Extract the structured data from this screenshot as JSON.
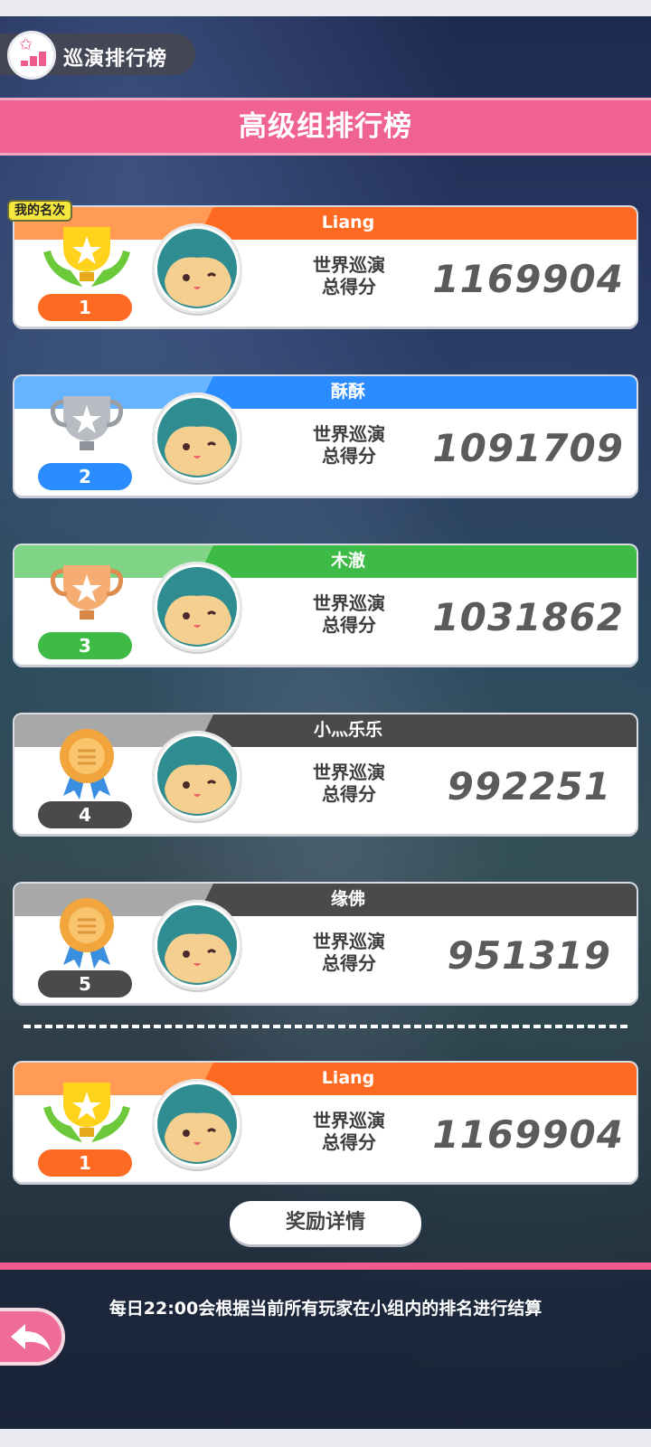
{
  "header": {
    "tab_label": "巡演排行榜",
    "title": "高级组排行榜"
  },
  "my_rank_badge": "我的名次",
  "score_label_line1": "世界巡演",
  "score_label_line2": "总得分",
  "ranks": [
    {
      "rank": "1",
      "name": "Liang",
      "score": "1169904",
      "color": "#ff6a22",
      "light": "#ff9b55",
      "trophy": "gold-trophy-icon"
    },
    {
      "rank": "2",
      "name": "酥酥",
      "score": "1091709",
      "color": "#2b8cff",
      "light": "#66b4ff",
      "trophy": "silver-trophy-icon"
    },
    {
      "rank": "3",
      "name": "木澈",
      "score": "1031862",
      "color": "#3dbb46",
      "light": "#7fd486",
      "trophy": "bronze-trophy-icon"
    },
    {
      "rank": "4",
      "name": "小灬乐乐",
      "score": "992251",
      "color": "#4a4a4a",
      "light": "#a8a8a8",
      "trophy": "medal-icon"
    },
    {
      "rank": "5",
      "name": "缘佛",
      "score": "951319",
      "color": "#4a4a4a",
      "light": "#a8a8a8",
      "trophy": "medal-icon"
    }
  ],
  "me": {
    "rank": "1",
    "name": "Liang",
    "score": "1169904"
  },
  "reward_button": "奖励详情",
  "footer_note": "每日22:00会根据当前所有玩家在小组内的排名进行结算"
}
